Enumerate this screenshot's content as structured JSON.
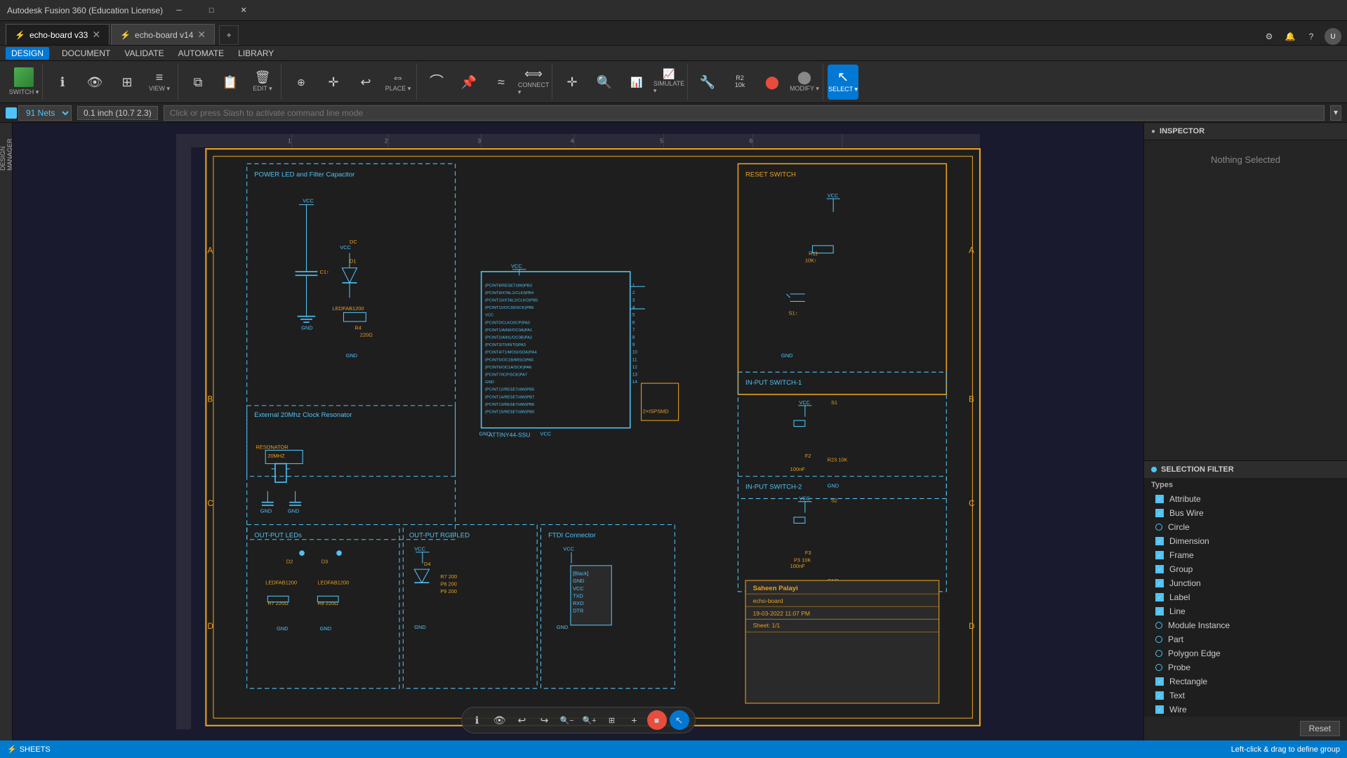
{
  "app": {
    "title": "Autodesk Fusion 360 (Education License)"
  },
  "tabs": [
    {
      "id": "tab1",
      "label": "echo-board v33",
      "active": true,
      "icon": "⚡"
    },
    {
      "id": "tab2",
      "label": "echo-board v14",
      "active": false,
      "icon": "⚡"
    }
  ],
  "menu": {
    "items": [
      "DESIGN",
      "DOCUMENT",
      "VALIDATE",
      "AUTOMATE",
      "LIBRARY"
    ]
  },
  "toolbar": {
    "groups": [
      {
        "name": "switch",
        "label": "SWITCH ▾",
        "buttons": [
          {
            "id": "switch-btn",
            "icon": "⬛",
            "label": "SWITCH",
            "has_arrow": true
          }
        ]
      },
      {
        "name": "view",
        "label": "VIEW ▾",
        "buttons": [
          {
            "id": "info-btn",
            "icon": "ℹ",
            "label": ""
          },
          {
            "id": "eye-btn",
            "icon": "👁",
            "label": ""
          },
          {
            "id": "grid-btn",
            "icon": "⊞",
            "label": ""
          },
          {
            "id": "layers-btn",
            "icon": "≡",
            "label": "VIEW",
            "has_arrow": true
          }
        ]
      },
      {
        "name": "edit",
        "label": "EDIT ▾",
        "buttons": [
          {
            "id": "copy-btn",
            "icon": "⧉",
            "label": ""
          },
          {
            "id": "paste-btn",
            "icon": "📋",
            "label": ""
          },
          {
            "id": "delete-btn",
            "icon": "🗑",
            "label": "EDIT",
            "has_arrow": true
          }
        ]
      },
      {
        "name": "place",
        "label": "PLACE ▾",
        "buttons": [
          {
            "id": "add-btn",
            "icon": "➕",
            "label": ""
          },
          {
            "id": "move-btn",
            "icon": "✛",
            "label": ""
          },
          {
            "id": "undo-btn",
            "icon": "↩",
            "label": ""
          },
          {
            "id": "mirror-btn",
            "icon": "⇔",
            "label": "PLACE",
            "has_arrow": true
          }
        ]
      },
      {
        "name": "connect",
        "label": "CONNECT ▾",
        "buttons": [
          {
            "id": "wire-btn",
            "icon": "⌒",
            "label": ""
          },
          {
            "id": "pin-btn",
            "icon": "📌",
            "label": ""
          },
          {
            "id": "bus-btn",
            "icon": "≈",
            "label": ""
          },
          {
            "id": "connect-btn",
            "icon": "⟺",
            "label": "CONNECT",
            "has_arrow": true
          }
        ]
      },
      {
        "name": "simulate",
        "label": "SIMULATE ▾",
        "buttons": [
          {
            "id": "cross-btn",
            "icon": "✛",
            "label": ""
          },
          {
            "id": "zoom-btn",
            "icon": "🔍",
            "label": ""
          },
          {
            "id": "sim1-btn",
            "icon": "📊",
            "label": ""
          },
          {
            "id": "sim2-btn",
            "icon": "📈",
            "label": "SIMULATE",
            "has_arrow": true
          }
        ]
      },
      {
        "name": "modify",
        "label": "MODIFY ▾",
        "buttons": [
          {
            "id": "mod1-btn",
            "icon": "🔧",
            "label": ""
          },
          {
            "id": "mod2-btn",
            "icon": "R2\n10k",
            "label": ""
          },
          {
            "id": "mod3-btn",
            "icon": "⬤",
            "label": ""
          },
          {
            "id": "mod4-btn",
            "icon": "⬤",
            "label": "MODIFY",
            "has_arrow": true
          }
        ]
      },
      {
        "name": "select",
        "label": "SELECT ▾",
        "buttons": [
          {
            "id": "select-btn",
            "icon": "↖",
            "label": "SELECT",
            "active": true,
            "has_arrow": true
          }
        ]
      }
    ]
  },
  "statusbar": {
    "nets": "91 Nets",
    "coords": "0.1 inch (10.7 2.3)",
    "command_placeholder": "Click or press Slash to activate command line mode"
  },
  "inspector": {
    "title": "INSPECTOR",
    "nothing_selected": "Nothing Selected"
  },
  "selection_filter": {
    "title": "SELECTION FILTER",
    "types_label": "Types",
    "items": [
      {
        "label": "Attribute",
        "checked": true,
        "type": "checkbox"
      },
      {
        "label": "Bus Wire",
        "checked": true,
        "type": "checkbox"
      },
      {
        "label": "Circle",
        "checked": true,
        "type": "circle"
      },
      {
        "label": "Dimension",
        "checked": true,
        "type": "checkbox"
      },
      {
        "label": "Frame",
        "checked": true,
        "type": "checkbox"
      },
      {
        "label": "Group",
        "checked": true,
        "type": "checkbox"
      },
      {
        "label": "Junction",
        "checked": true,
        "type": "checkbox"
      },
      {
        "label": "Label",
        "checked": true,
        "type": "checkbox"
      },
      {
        "label": "Line",
        "checked": true,
        "type": "checkbox"
      },
      {
        "label": "Module Instance",
        "checked": true,
        "type": "circle"
      },
      {
        "label": "Part",
        "checked": true,
        "type": "circle"
      },
      {
        "label": "Polygon Edge",
        "checked": true,
        "type": "circle"
      },
      {
        "label": "Probe",
        "checked": true,
        "type": "circle"
      },
      {
        "label": "Rectangle",
        "checked": true,
        "type": "checkbox"
      },
      {
        "label": "Text",
        "checked": true,
        "type": "checkbox"
      },
      {
        "label": "Wire",
        "checked": true,
        "type": "checkbox"
      }
    ],
    "reset_label": "Reset"
  },
  "bottom_status": {
    "icon": "⚡",
    "sheets_label": "SHEETS"
  },
  "canvas_toolbar": {
    "buttons": [
      {
        "id": "info-c",
        "icon": "ℹ",
        "label": "info"
      },
      {
        "id": "eye-c",
        "icon": "👁",
        "label": "eye"
      },
      {
        "id": "undo-c",
        "icon": "↩",
        "label": "undo"
      },
      {
        "id": "redo-c",
        "icon": "↪",
        "label": "redo"
      },
      {
        "id": "zoom-minus",
        "icon": "🔍",
        "label": "zoom-minus"
      },
      {
        "id": "zoom-plus",
        "icon": "🔍",
        "label": "zoom-plus"
      },
      {
        "id": "fit-c",
        "icon": "⊞",
        "label": "fit"
      },
      {
        "id": "grid-c",
        "icon": "+",
        "label": "grid"
      },
      {
        "id": "stop-c",
        "icon": "⏹",
        "label": "stop",
        "active": true,
        "color": "red"
      },
      {
        "id": "cursor-c",
        "icon": "↖",
        "label": "cursor",
        "active": true
      }
    ]
  },
  "left_sidebar": {
    "items": [
      {
        "label": "DESIGN MANAGER",
        "id": "design-manager"
      }
    ]
  },
  "bottom_statusbar": {
    "left_text": "Left-click & drag to define group"
  }
}
